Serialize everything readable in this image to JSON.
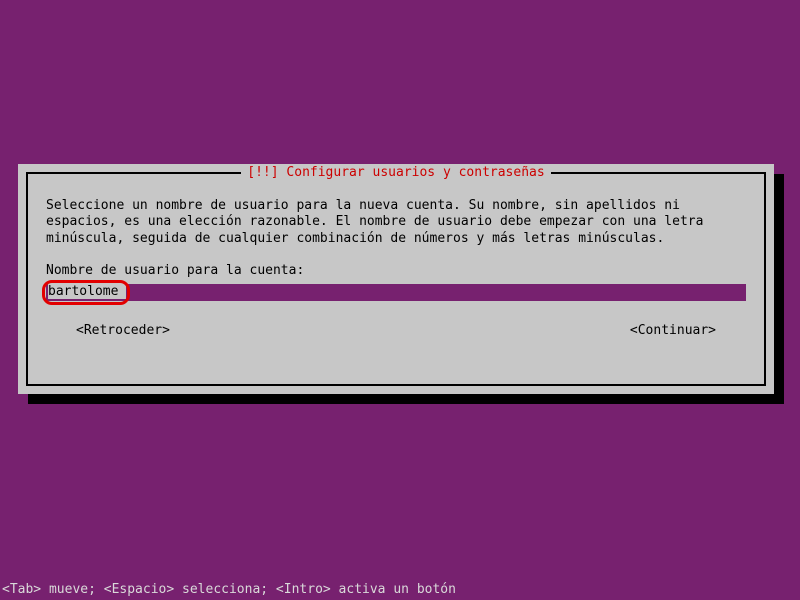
{
  "dialog": {
    "title": "[!!] Configurar usuarios y contraseñas",
    "body": "Seleccione un nombre de usuario para la nueva cuenta. Su nombre, sin apellidos ni\nespacios, es una elección razonable. El nombre de usuario debe empezar con una letra\nminúscula, seguida de cualquier combinación de números y más letras minúsculas.",
    "prompt": "Nombre de usuario para la cuenta:",
    "input_value": "bartolome",
    "back_label": "<Retroceder>",
    "continue_label": "<Continuar>"
  },
  "status_bar": "<Tab> mueve; <Espacio> selecciona; <Intro> activa un botón"
}
